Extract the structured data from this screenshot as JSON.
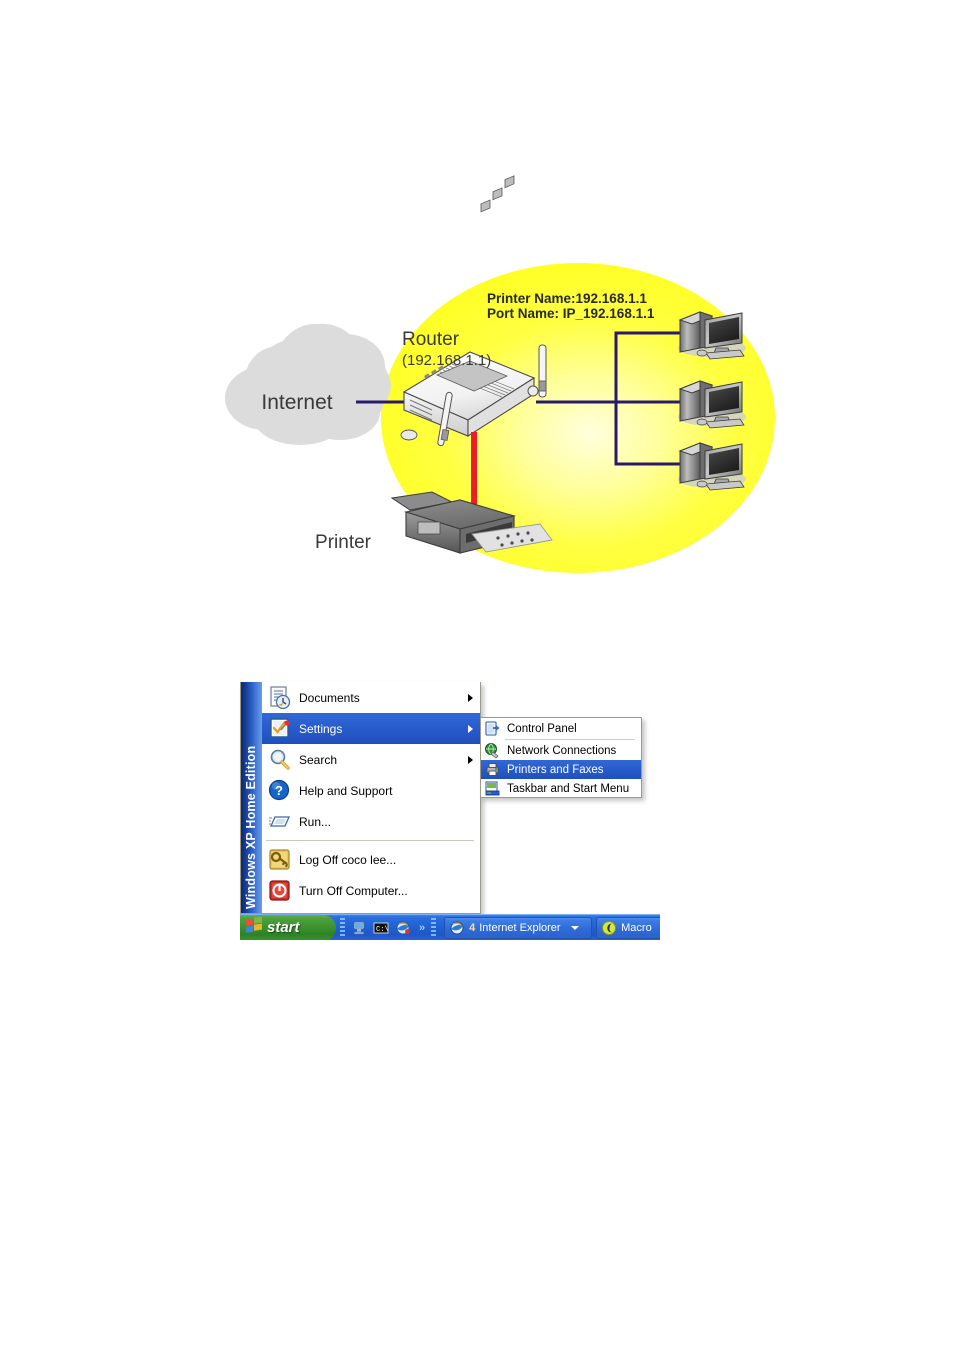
{
  "diagram": {
    "cloud_label": "Internet",
    "router_label": "Router",
    "router_ip": "(192.168.1.1)",
    "printer_name_line": "Printer Name:192.168.1.1",
    "port_name_line": "Port Name: IP_192.168.1.1",
    "printer_label": "Printer",
    "colors": {
      "zone_fill": "#ffff33",
      "zone_center": "#ffffcc",
      "cloud_fill": "#dcdcdc",
      "link_line": "#2b1a6b",
      "printer_cable": "#ee1c25",
      "text": "#333333"
    },
    "nodes": [
      {
        "name": "internet-cloud",
        "type": "cloud"
      },
      {
        "name": "router",
        "type": "router"
      },
      {
        "name": "printer",
        "type": "printer"
      },
      {
        "name": "pc-1",
        "type": "computer"
      },
      {
        "name": "pc-2",
        "type": "computer"
      },
      {
        "name": "pc-3",
        "type": "computer"
      }
    ]
  },
  "startmenu": {
    "brand": "Windows XP  Home Edition",
    "items": [
      {
        "label": "Documents",
        "icon": "documents-icon",
        "arrow": true,
        "selected": false
      },
      {
        "label": "Settings",
        "icon": "settings-icon",
        "arrow": true,
        "selected": true
      },
      {
        "label": "Search",
        "icon": "search-icon",
        "arrow": true,
        "selected": false
      },
      {
        "label": "Help and Support",
        "icon": "help-icon",
        "arrow": false,
        "selected": false
      },
      {
        "label": "Run...",
        "icon": "run-icon",
        "arrow": false,
        "selected": false
      },
      {
        "label": "Log Off coco lee...",
        "icon": "log-off-icon",
        "arrow": false,
        "selected": false
      },
      {
        "label": "Turn Off Computer...",
        "icon": "turn-off-icon",
        "arrow": false,
        "selected": false
      }
    ],
    "submenu": [
      {
        "label": "Control Panel",
        "icon": "control-panel-icon",
        "selected": false
      },
      {
        "label": "Network Connections",
        "icon": "network-icon",
        "selected": false
      },
      {
        "label": "Printers and Faxes",
        "icon": "printer-icon",
        "selected": true
      },
      {
        "label": "Taskbar and Start Menu",
        "icon": "taskbar-icon",
        "selected": false
      }
    ]
  },
  "taskbar": {
    "start_label": "start",
    "quick_launch": [
      {
        "name": "show-desktop-icon"
      },
      {
        "name": "command-prompt-icon"
      },
      {
        "name": "internet-explorer-icon"
      }
    ],
    "chevron": "»",
    "tasks": [
      {
        "count": "4",
        "label": "Internet Explorer",
        "icon": "internet-explorer-icon",
        "has_caret": true
      },
      {
        "count": "",
        "label": "Macro",
        "icon": "macromedia-icon",
        "has_caret": false
      }
    ]
  }
}
